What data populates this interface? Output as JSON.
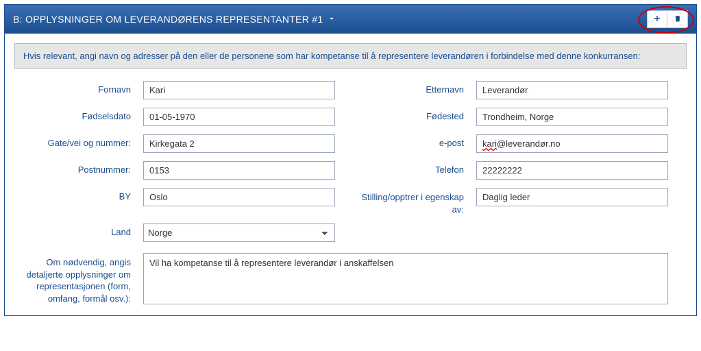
{
  "header": {
    "title": "B: OPPLYSNINGER OM LEVERANDØRENS REPRESENTANTER #1"
  },
  "banner": "Hvis relevant, angi navn og adresser på den eller de personene som har kompetanse til å representere leverandøren i forbindelse med denne konkurransen:",
  "labels": {
    "fornavn": "Fornavn",
    "etternavn": "Etternavn",
    "fodselsdato": "Fødselsdato",
    "fodested": "Fødested",
    "gate": "Gate/vei og nummer:",
    "epost": "e-post",
    "postnummer": "Postnummer:",
    "telefon": "Telefon",
    "by": "BY",
    "stilling": "Stilling/opptrer i egenskap av:",
    "land": "Land",
    "detaljer": "Om nødvendig, angis detaljerte opplysninger om representasjonen (form, omfang, formål osv.):"
  },
  "values": {
    "fornavn": "Kari",
    "etternavn": "Leverandør",
    "fodselsdato": "01-05-1970",
    "fodested": "Trondheim, Norge",
    "gate": "Kirkegata 2",
    "epost_user": "kari",
    "epost_rest": "@leverandør.no",
    "postnummer": "0153",
    "telefon": "22222222",
    "by": "Oslo",
    "stilling": "Daglig leder",
    "land": "Norge",
    "detaljer": "Vil ha kompetanse til å representere leverandør i anskaffelsen"
  }
}
